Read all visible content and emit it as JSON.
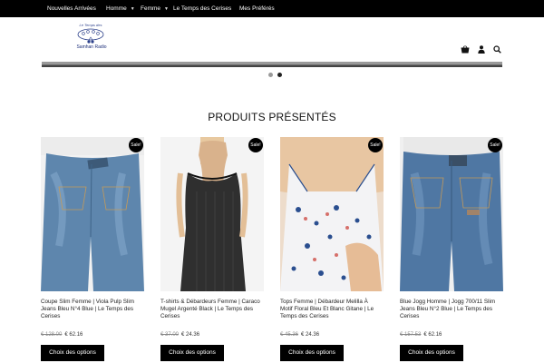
{
  "top_nav": {
    "items": [
      "Nouvelles Arrivées",
      "Homme",
      "Femme",
      "Le Temps des Cerises",
      "Mes Préférés"
    ]
  },
  "logo": {
    "tagline": "Le Temps des",
    "name": "Samhan Radio"
  },
  "header_icons": [
    "basket-icon",
    "user-icon",
    "search-icon"
  ],
  "slider": {
    "dots": 2,
    "active": 1
  },
  "section_title": "PRODUITS PRÉSENTÉS",
  "products": [
    {
      "title": "Coupe Slim Femme | Viola Pulp Slim Jeans Bleu N°4 Blue | Le Temps des Cerises",
      "old_price": "€ 128.00",
      "price": "€ 62.16",
      "badge": "Sale!",
      "button": "Choix des options"
    },
    {
      "title": "T-shirts & Débardeurs Femme | Caraco Mugel Argenté Black | Le Temps des Cerises",
      "old_price": "€ 37.00",
      "price": "€ 24.36",
      "badge": "Sale!",
      "button": "Choix des options"
    },
    {
      "title": "Tops Femme | Débardeur Melilla À Motif Floral Bleu Et Blanc Gitane | Le Temps des Cerises",
      "old_price": "€ 45.36",
      "price": "€ 24.36",
      "badge": "Sale!",
      "button": "Choix des options"
    },
    {
      "title": "Blue Jogg Homme | Jogg 700/11 Slim Jeans Bleu N°2 Blue | Le Temps des Cerises",
      "old_price": "€ 157.53",
      "price": "€ 62.16",
      "badge": "Sale!",
      "button": "Choix des options"
    }
  ]
}
